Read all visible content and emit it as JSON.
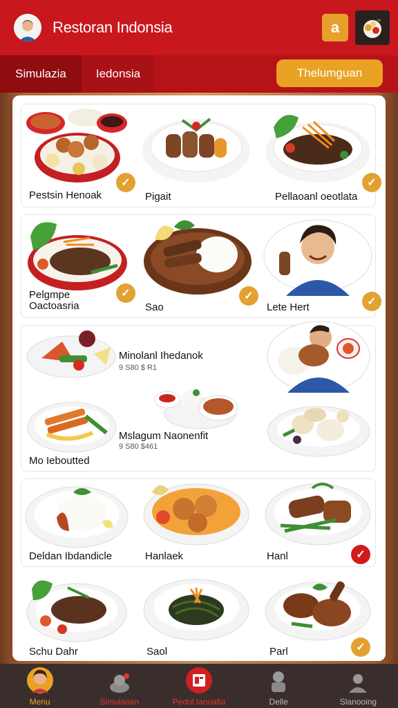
{
  "header": {
    "title": "Restoran Indonsia",
    "icon_button": "a",
    "colors": {
      "primary": "#c8171d",
      "accent": "#e9a224"
    }
  },
  "tabs": {
    "simulation": "Simulazia",
    "indonesia": "Iedonsia",
    "cta": "Thelumguan"
  },
  "menu": {
    "items": [
      {
        "name": "Pestsin Henoak",
        "checked": true
      },
      {
        "name": "Pigait",
        "checked": false
      },
      {
        "name": "Pellaoanl oeotlata",
        "checked": true
      },
      {
        "name_line1": "Pelgmpe",
        "name_line2": "Oactoasria",
        "checked": true
      },
      {
        "name": "Sao",
        "checked": true
      },
      {
        "name": "Lete Hert",
        "checked": true
      },
      {
        "name": "Minolanl Ihedanok",
        "price": "9 S80 $ R1"
      },
      {
        "name": "Mslagum Naonenfit",
        "price": "9 S80 $461"
      },
      {
        "name": "Mo Ieboutted"
      },
      {
        "name": "Deldan Ibdandicle"
      },
      {
        "name": "Hanlaek"
      },
      {
        "name": "Hanl",
        "checked": true
      },
      {
        "name": "Schu Dahr"
      },
      {
        "name": "Saol"
      },
      {
        "name": "Parl",
        "checked": true
      }
    ]
  },
  "bottom_nav": {
    "menu": "Menu",
    "simulation": "Simulaoan",
    "order": "Pedol Ianuafia",
    "detail": "Delle",
    "settings": "Slanooing"
  }
}
